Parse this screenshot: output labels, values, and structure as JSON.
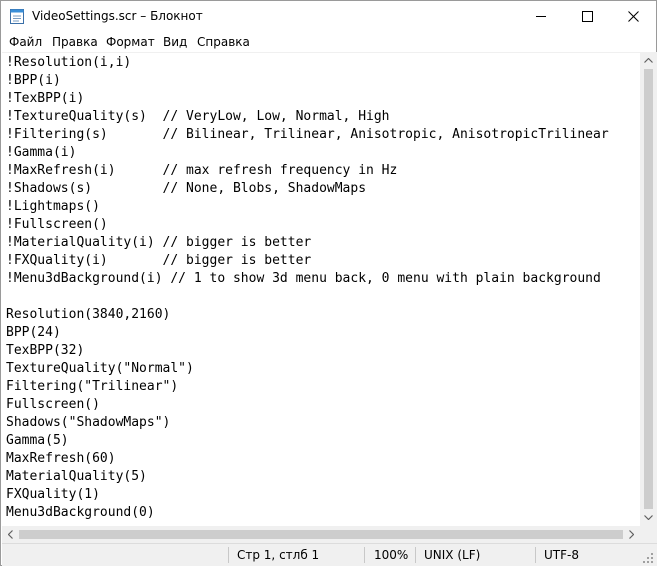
{
  "window": {
    "title": "VideoSettings.scr – Блокнот"
  },
  "menu": {
    "items": [
      "Файл",
      "Правка",
      "Формат",
      "Вид",
      "Справка"
    ]
  },
  "editor": {
    "lines": [
      "!Resolution(i,i)",
      "!BPP(i)",
      "!TexBPP(i)",
      "!TextureQuality(s)  // VeryLow, Low, Normal, High",
      "!Filtering(s)       // Bilinear, Trilinear, Anisotropic, AnisotropicTrilinear",
      "!Gamma(i)",
      "!MaxRefresh(i)      // max refresh frequency in Hz",
      "!Shadows(s)         // None, Blobs, ShadowMaps",
      "!Lightmaps()",
      "!Fullscreen()",
      "!MaterialQuality(i) // bigger is better",
      "!FXQuality(i)       // bigger is better",
      "!Menu3dBackground(i) // 1 to show 3d menu back, 0 menu with plain background",
      "",
      "Resolution(3840,2160)",
      "BPP(24)",
      "TexBPP(32)",
      "TextureQuality(\"Normal\")",
      "Filtering(\"Trilinear\")",
      "Fullscreen()",
      "Shadows(\"ShadowMaps\")",
      "Gamma(5)",
      "MaxRefresh(60)",
      "MaterialQuality(5)",
      "FXQuality(1)",
      "Menu3dBackground(0)"
    ]
  },
  "statusbar": {
    "position": "Стр 1, стлб 1",
    "zoom": "100%",
    "line_endings": "UNIX (LF)",
    "encoding": "UTF-8"
  },
  "icons": {
    "app": "notepad-icon",
    "minimize": "minimize-icon",
    "maximize": "maximize-icon",
    "close": "close-icon"
  }
}
